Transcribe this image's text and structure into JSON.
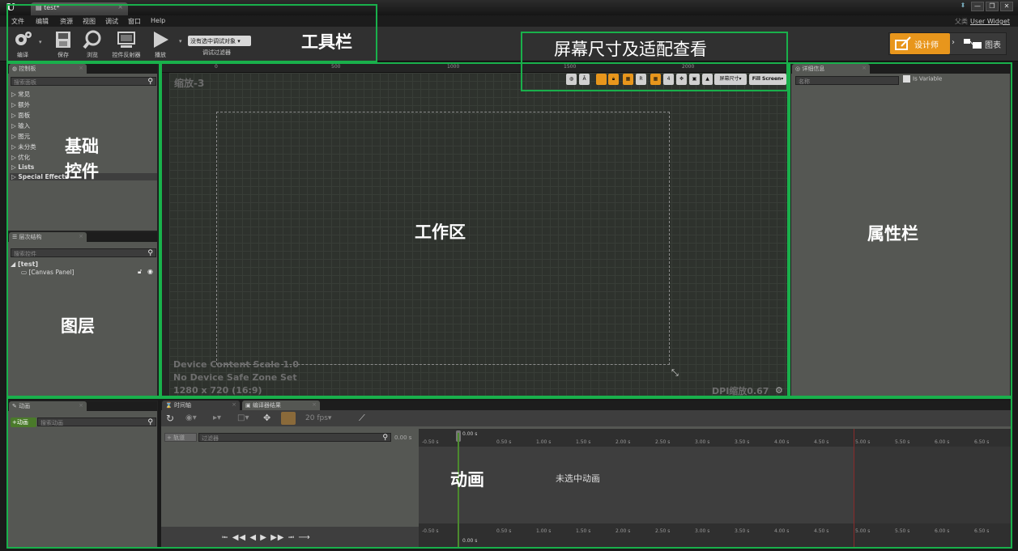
{
  "window": {
    "app_logo": "U",
    "doc_tab": "test*",
    "controls": [
      "⬍",
      "—",
      "❐",
      "✕"
    ],
    "breadcrumb_parent": "父类",
    "breadcrumb_class": "User Widget"
  },
  "menu": [
    "文件",
    "编辑",
    "资源",
    "视图",
    "调试",
    "窗口",
    "Help"
  ],
  "toolbar": {
    "compile": "编译",
    "save": "保存",
    "browse": "浏览",
    "widget_reflector": "控件反射器",
    "play": "播放",
    "debug_select": "没有选中调试对象",
    "debug_filter": "调试过滤器",
    "designer_mode": "设计师",
    "graph_mode": "图表"
  },
  "palette": {
    "tab": "控制板",
    "search_placeholder": "搜索面板",
    "categories": [
      "常见",
      "额外",
      "面板",
      "输入",
      "图元",
      "未分类",
      "优化",
      "Lists",
      "Special Effects"
    ]
  },
  "hierarchy": {
    "tab": "层次结构",
    "search_placeholder": "搜索控件",
    "root": "[test]",
    "child": "[Canvas Panel]"
  },
  "designer": {
    "zoom": "缩放-3",
    "ruler_labels": [
      "0",
      "500",
      "1000",
      "1500",
      "2000"
    ],
    "screen_size": "屏幕尺寸",
    "fill_screen": "Fill Screen",
    "device_scale": "Device Content Scale 1.0",
    "safe_zone": "No Device Safe Zone Set",
    "resolution": "1280 x 720 (16:9)",
    "dpi": "DPI缩放0.67"
  },
  "details": {
    "tab": "详细信息",
    "name_placeholder": "名称",
    "is_variable": "Is Variable"
  },
  "animations": {
    "tab": "动画",
    "add_button": "+动画",
    "search_placeholder": "搜索动画"
  },
  "timeline": {
    "tab": "时间轴",
    "tab2": "编译器结果",
    "track_button": "轨道",
    "filter_placeholder": "过滤器",
    "fps": "20 fps",
    "time_start": "0.00 s",
    "time_left": "-0.50 s",
    "ticks": [
      "0.50 s",
      "1.00 s",
      "1.50 s",
      "2.00 s",
      "2.50 s",
      "3.00 s",
      "3.50 s",
      "4.00 s",
      "4.50 s",
      "5.00 s",
      "5.50 s",
      "6.00 s",
      "6.50 s"
    ],
    "no_animation": "未选中动画"
  },
  "annotations": {
    "toolbar": "工具栏",
    "screen": "屏幕尺寸及适配查看",
    "basic_widgets_1": "基础",
    "basic_widgets_2": "控件",
    "layers": "图层",
    "workspace": "工作区",
    "properties": "属性栏",
    "animation": "动画"
  },
  "colors": {
    "accent_orange": "#e8961c",
    "annotation_green": "#19b04b",
    "panel_gray": "#555753"
  }
}
